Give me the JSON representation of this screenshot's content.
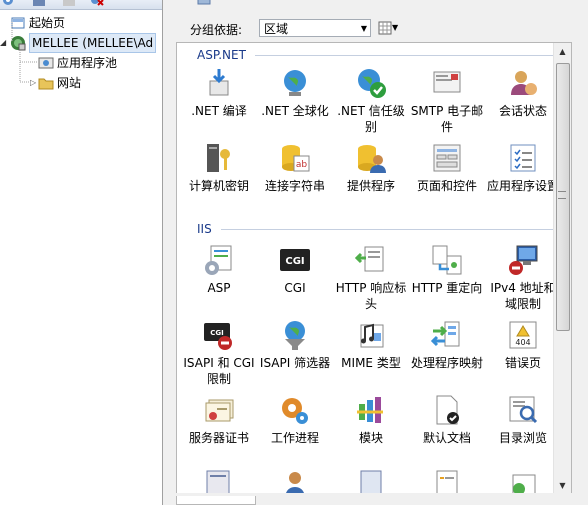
{
  "tree": {
    "start_page": "起始页",
    "server": "MELLEE (MELLEE\\Ad",
    "app_pools": "应用程序池",
    "sites": "网站"
  },
  "filter": {
    "label": "分组依据:",
    "value": "区域"
  },
  "sections": {
    "aspnet": {
      "title": "ASP.NET",
      "items": [
        {
          "label": ".NET 编译",
          "icon": "net-compilation-icon"
        },
        {
          "label": ".NET 全球化",
          "icon": "net-globalization-icon"
        },
        {
          "label": ".NET 信任级别",
          "icon": "net-trust-levels-icon"
        },
        {
          "label": "SMTP 电子邮件",
          "icon": "smtp-email-icon"
        },
        {
          "label": "会话状态",
          "icon": "session-state-icon"
        },
        {
          "label": "计算机密钥",
          "icon": "machine-key-icon"
        },
        {
          "label": "连接字符串",
          "icon": "connection-strings-icon"
        },
        {
          "label": "提供程序",
          "icon": "providers-icon"
        },
        {
          "label": "页面和控件",
          "icon": "pages-controls-icon"
        },
        {
          "label": "应用程序设置",
          "icon": "app-settings-icon"
        }
      ]
    },
    "iis": {
      "title": "IIS",
      "items": [
        {
          "label": "ASP",
          "icon": "asp-icon"
        },
        {
          "label": "CGI",
          "icon": "cgi-icon"
        },
        {
          "label": "HTTP 响应标头",
          "icon": "http-response-headers-icon"
        },
        {
          "label": "HTTP 重定向",
          "icon": "http-redirect-icon"
        },
        {
          "label": "IPv4 地址和域限制",
          "icon": "ipv4-restrictions-icon"
        },
        {
          "label": "ISAPI 和 CGI 限制",
          "icon": "isapi-cgi-restrictions-icon"
        },
        {
          "label": "ISAPI 筛选器",
          "icon": "isapi-filters-icon"
        },
        {
          "label": "MIME 类型",
          "icon": "mime-types-icon"
        },
        {
          "label": "处理程序映射",
          "icon": "handler-mappings-icon"
        },
        {
          "label": "错误页",
          "icon": "error-pages-icon"
        },
        {
          "label": "服务器证书",
          "icon": "server-certificates-icon"
        },
        {
          "label": "工作进程",
          "icon": "worker-processes-icon"
        },
        {
          "label": "模块",
          "icon": "modules-icon"
        },
        {
          "label": "默认文档",
          "icon": "default-document-icon"
        },
        {
          "label": "目录浏览",
          "icon": "directory-browsing-icon"
        }
      ]
    }
  },
  "error_page_badge": "404",
  "cgi_badge": "CGI",
  "cgi_small_badge": "CGI",
  "ab_badge": "ab"
}
